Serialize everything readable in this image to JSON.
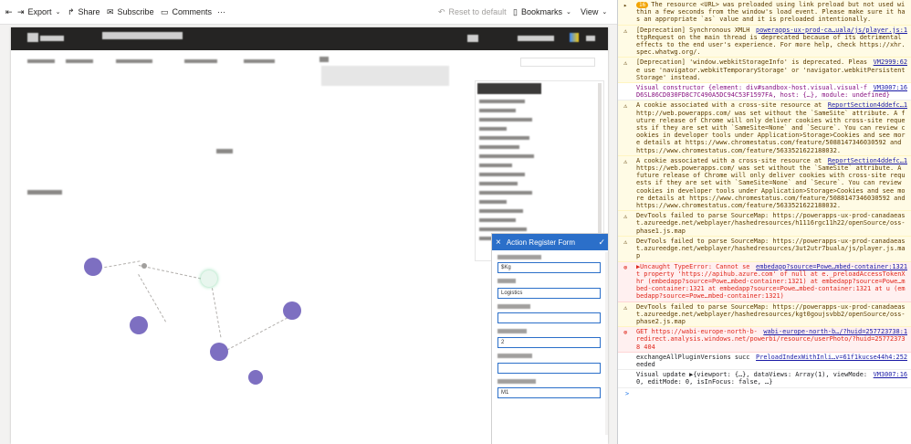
{
  "toolbar": {
    "export": "Export",
    "share": "Share",
    "subscribe": "Subscribe",
    "comments": "Comments",
    "more": "···",
    "reset": "Reset to default",
    "bookmarks": "Bookmarks",
    "view": "View"
  },
  "form": {
    "title": "Action Register Form",
    "field_values": [
      "$Kg",
      "Logistics",
      "",
      "2",
      "",
      "M1"
    ]
  },
  "console": {
    "badge": "16",
    "messages": [
      {
        "level": "warn",
        "src": "",
        "text": "The resource <URL> was preloaded using link preload but not used within a few seconds from the window's load event. Please make sure it has an appropriate `as` value and it is preloaded intentionally."
      },
      {
        "level": "warn",
        "src": "powerapps-ux-prod-ca…uala/js/player.js:1",
        "text": "[Deprecation] Synchronous XMLHttpRequest on the main thread is deprecated because of its detrimental effects to the end user's experience. For more help, check https://xhr.spec.whatwg.org/."
      },
      {
        "level": "warn",
        "src": "VM2999:62",
        "text": "[Deprecation] 'window.webkitStorageInfo' is deprecated. Please use 'navigator.webkitTemporaryStorage' or 'navigator.webkitPersistentStorage' instead."
      },
      {
        "level": "log",
        "src": "VM3007:16",
        "text": "Visual constructor {element: div#sandbox-host.visual.visual-fD6SL86CD030FD8C7C490A5DC94C53F1597FA, host: {…}, module: undefined}"
      },
      {
        "level": "warn",
        "src": "ReportSection4ddefc…1",
        "text": "A cookie associated with a cross-site resource at http://web.powerapps.com/ was set without the `SameSite` attribute. A future release of Chrome will only deliver cookies with cross-site requests if they are set with `SameSite=None` and `Secure`. You can review cookies in developer tools under Application>Storage>Cookies and see more details at https://www.chromestatus.com/feature/5088147346030592 and https://www.chromestatus.com/feature/5633521622188032."
      },
      {
        "level": "warn",
        "src": "ReportSection4ddefc…1",
        "text": "A cookie associated with a cross-site resource at https://web.powerapps.com/ was set without the `SameSite` attribute. A future release of Chrome will only deliver cookies with cross-site requests if they are set with `SameSite=None` and `Secure`. You can review cookies in developer tools under Application>Storage>Cookies and see more details at https://www.chromestatus.com/feature/5088147346030592 and https://www.chromestatus.com/feature/5633521622188032."
      },
      {
        "level": "warn",
        "src": "",
        "text": "DevTools failed to parse SourceMap: https://powerapps-ux-prod-canadaeast.azureedge.net/webplayer/hashedresources/h1116rgc11h22/openSource/oss-phase1.js.map"
      },
      {
        "level": "warn",
        "src": "",
        "text": "DevTools failed to parse SourceMap: https://powerapps-ux-prod-canadaeast.azureedge.net/webplayer/hashedresources/3ut2utr7buala/js/player.js.map"
      },
      {
        "level": "err",
        "src": "embedapp?source=Powe…mbed-container:1321",
        "text": "▶Uncaught TypeError: Cannot set property 'https://apihub.azure.com' of null at e._preloadAccessTokenXhr (embedapp?source=Powe…mbed-container:1321) at embedapp?source=Powe…mbed-container:1321 at embedapp?source=Powe…mbed-container:1321 at u (embedapp?source=Powe…mbed-container:1321)"
      },
      {
        "level": "warn",
        "src": "",
        "text": "DevTools failed to parse SourceMap: https://powerapps-ux-prod-canadaeast.azureedge.net/webplayer/hashedresources/kgt0goujsvbb2/openSource/oss-phase2.js.map"
      },
      {
        "level": "err",
        "src": "wabi-europe-north-b…/?huid=257723738:1",
        "text": "GET https://wabi-europe-north-b-redirect.analysis.windows.net/powerbi/resource/userPhoto/?huid=257723738 404"
      },
      {
        "level": "log",
        "src": "PreloadIndexWithInli…v=61f1kucse44h4:252",
        "text": "exchangeAllPluginVersions succeeded"
      },
      {
        "level": "log",
        "src": "VM3007:16",
        "text": "Visual update ▶{viewport: {…}, dataViews: Array(1), viewMode: 0, editMode: 0, isInFocus: false, …}"
      }
    ],
    "prompt": ">"
  }
}
